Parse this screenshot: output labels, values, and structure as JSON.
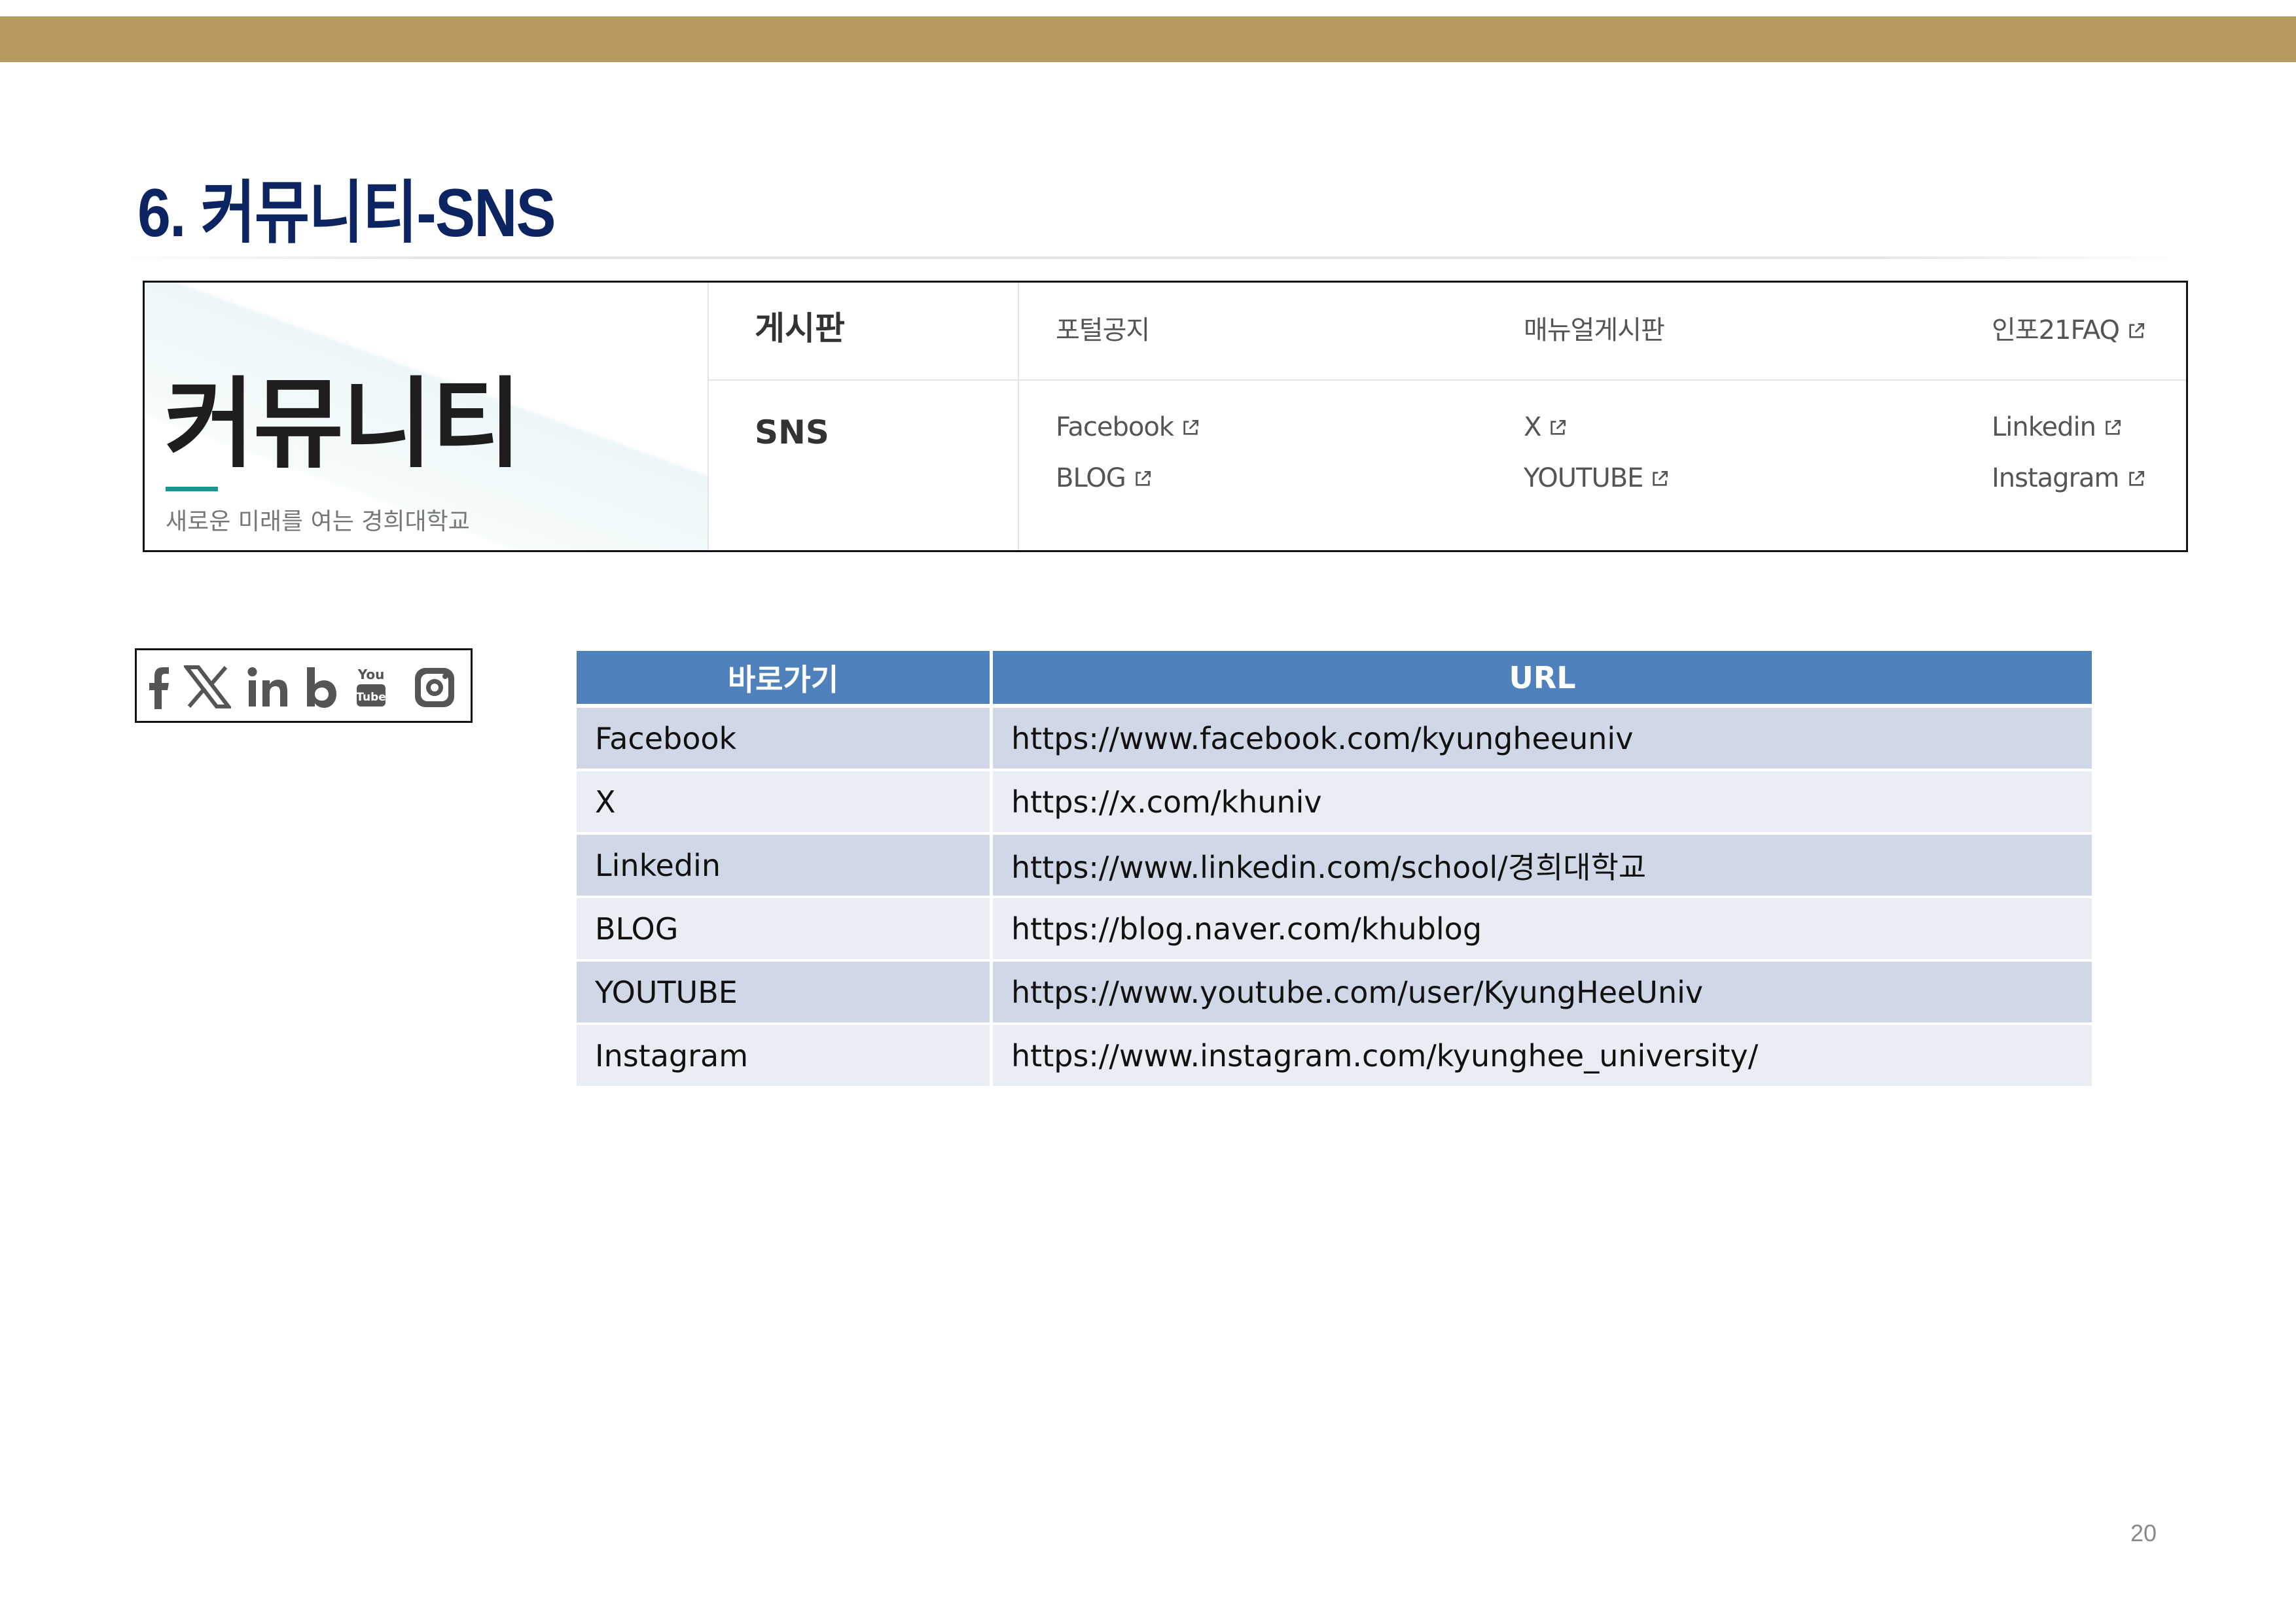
{
  "colors": {
    "top_bar": "#b5995d",
    "title": "#0c2562",
    "header_bg": "#4f81bd",
    "row_odd": "#d0d8e8",
    "row_even": "#e9edf4",
    "teal": "#17958e"
  },
  "title": "6.  커뮤니티-SNS",
  "portal": {
    "heading": "커뮤니티",
    "slogan": "새로운 미래를 여는 경희대학교",
    "board": {
      "label": "게시판",
      "links": [
        {
          "text": "포털공지",
          "external": false
        },
        {
          "text": "매뉴얼게시판",
          "external": false
        },
        {
          "text": "인포21FAQ",
          "external": true
        }
      ]
    },
    "sns": {
      "label": "SNS",
      "links": [
        {
          "text": "Facebook"
        },
        {
          "text": "X"
        },
        {
          "text": "Linkedin"
        },
        {
          "text": "BLOG"
        },
        {
          "text": "YOUTUBE"
        },
        {
          "text": "Instagram"
        }
      ]
    }
  },
  "icons": [
    "facebook-icon",
    "x-icon",
    "linkedin-icon",
    "blog-icon",
    "youtube-icon",
    "instagram-icon"
  ],
  "table": {
    "headers": [
      "바로가기",
      "URL"
    ],
    "rows": [
      {
        "name": "Facebook",
        "url": "https://www.facebook.com/kyungheeuniv"
      },
      {
        "name": "X",
        "url": "https://x.com/khuniv"
      },
      {
        "name": "Linkedin",
        "url": "https://www.linkedin.com/school/경희대학교"
      },
      {
        "name": "BLOG",
        "url": "https://blog.naver.com/khublog"
      },
      {
        "name": "YOUTUBE",
        "url": "https://www.youtube.com/user/KyungHeeUniv"
      },
      {
        "name": "Instagram",
        "url": "https://www.instagram.com/kyunghee_university/"
      }
    ]
  },
  "page_number": "20"
}
